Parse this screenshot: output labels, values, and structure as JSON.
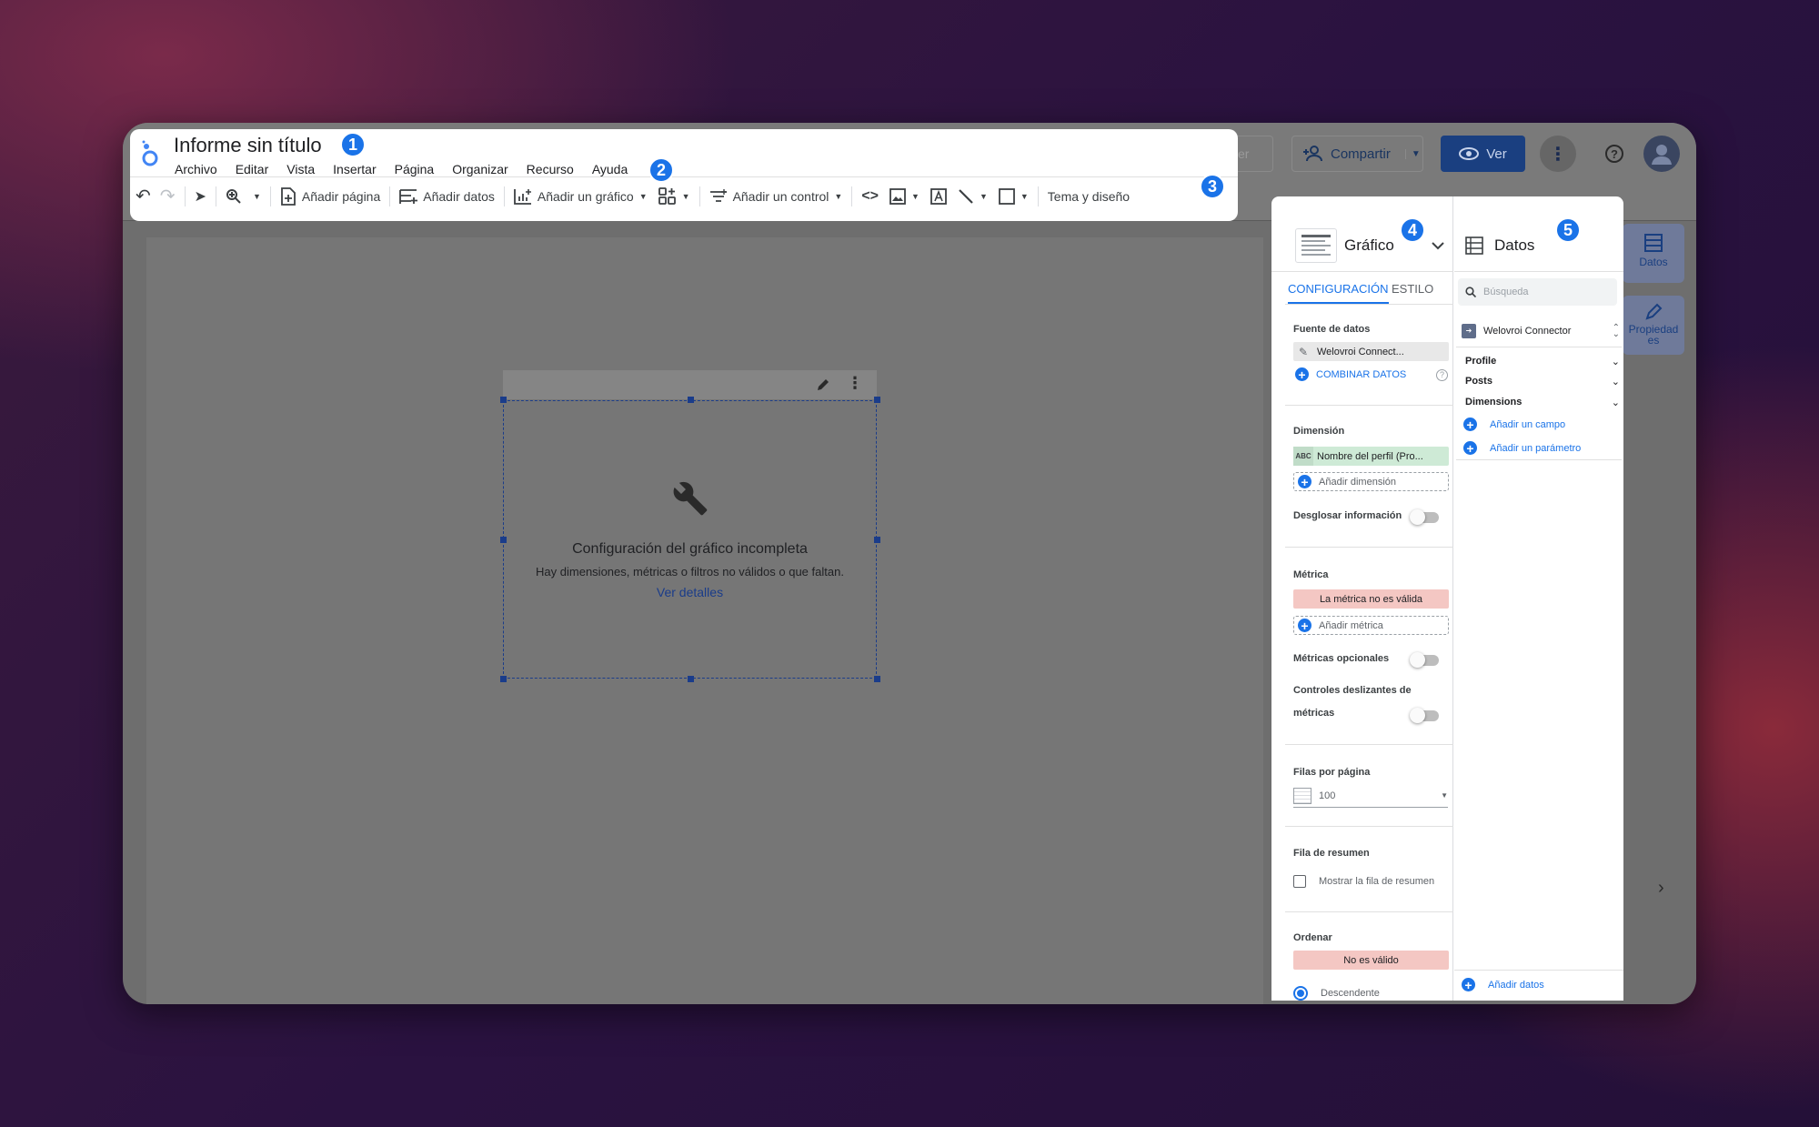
{
  "app": {
    "title": "Informe sin título"
  },
  "menu": [
    "Archivo",
    "Editar",
    "Vista",
    "Insertar",
    "Página",
    "Organizar",
    "Recurso",
    "Ayuda"
  ],
  "toolbar": {
    "add_page": "Añadir página",
    "add_data": "Añadir datos",
    "add_chart": "Añadir un gráfico",
    "add_control": "Añadir un control",
    "theme": "Tema y diseño"
  },
  "topright": {
    "restore": "Restablecer",
    "share": "Compartir",
    "view": "Ver"
  },
  "badges": [
    "1",
    "2",
    "3",
    "4",
    "5"
  ],
  "chart": {
    "title": "Configuración del gráfico incompleta",
    "desc": "Hay dimensiones, métricas o filtros no válidos o que faltan.",
    "link": "Ver detalles"
  },
  "panel": {
    "chart_type": "Gráfico",
    "tabs": {
      "config": "CONFIGURACIÓN",
      "style": "ESTILO"
    },
    "data_source_label": "Fuente de datos",
    "data_source": "Welovroi Connect...",
    "blend": "COMBINAR DATOS",
    "dimension_label": "Dimensión",
    "dimension_type": "ABC",
    "dimension": "Nombre del perfil (Pro...",
    "add_dimension": "Añadir dimensión",
    "drill": "Desglosar información",
    "metric_label": "Métrica",
    "metric_invalid": "La métrica no es válida",
    "add_metric": "Añadir métrica",
    "optional_metrics": "Métricas opcionales",
    "slider_controls_1": "Controles deslizantes de",
    "slider_controls_2": "métricas",
    "rows_label": "Filas por página",
    "rows_value": "100",
    "summary_label": "Fila de resumen",
    "summary_option": "Mostrar la fila de resumen",
    "sort_label": "Ordenar",
    "sort_invalid": "No es válido",
    "sort_desc": "Descendente"
  },
  "data_panel": {
    "title": "Datos",
    "search_placeholder": "Búsqueda",
    "connector": "Welovroi Connector",
    "groups": [
      "Profile",
      "Posts",
      "Dimensions"
    ],
    "add_field": "Añadir un campo",
    "add_param": "Añadir un parámetro",
    "add_data": "Añadir datos"
  },
  "side": {
    "data": "Datos",
    "props_1": "Propiedad",
    "props_2": "es"
  },
  "colors": {
    "accent": "#1a73e8",
    "invalid": "#f4c7c3",
    "dimension_chip": "#ceead6"
  }
}
